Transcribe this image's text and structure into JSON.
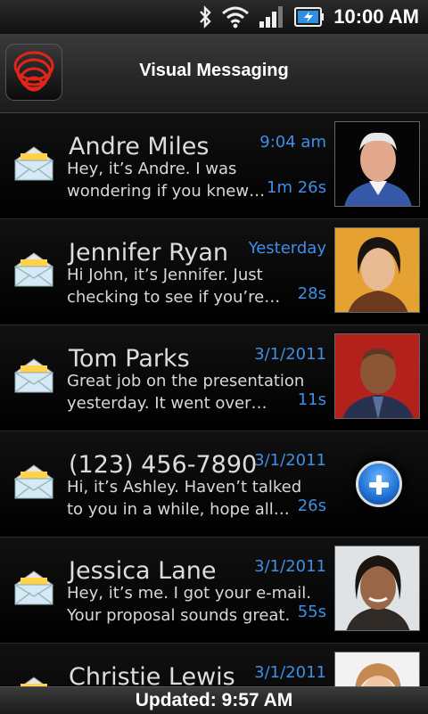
{
  "status_bar": {
    "time": "10:00 AM",
    "icons": [
      "bluetooth-icon",
      "wifi-icon",
      "signal-icon",
      "battery-charging-icon"
    ]
  },
  "app": {
    "title": "Visual Messaging",
    "logo": "app-logo-icon"
  },
  "messages": [
    {
      "name": "Andre Miles",
      "when": "9:04 am",
      "duration": "1m 26s",
      "preview_line1": "Hey, it’s Andre. I was",
      "preview_line2": "wondering if you knew…",
      "photo": "contact-photo"
    },
    {
      "name": "Jennifer Ryan",
      "when": "Yesterday",
      "duration": "28s",
      "preview_line1": "Hi John, it’s Jennifer. Just",
      "preview_line2": "checking to see if you’re…",
      "photo": "contact-photo"
    },
    {
      "name": "Tom Parks",
      "when": "3/1/2011",
      "duration": "11s",
      "preview_line1": "Great job on the presentation",
      "preview_line2": "yesterday. It went over…",
      "photo": "contact-photo"
    },
    {
      "name": "(123) 456-7890",
      "when": "3/1/2011",
      "duration": "26s",
      "preview_line1": "Hi, it’s Ashley. Haven’t talked",
      "preview_line2": "to you in a while, hope all…",
      "photo": "add-contact"
    },
    {
      "name": "Jessica Lane",
      "when": "3/1/2011",
      "duration": "55s",
      "preview_line1": "Hey, it’s me. I got your e-mail.",
      "preview_line2": "Your proposal sounds great.",
      "photo": "contact-photo"
    },
    {
      "name": "Christie Lewis",
      "when": "3/1/2011",
      "duration": "",
      "preview_line1": "",
      "preview_line2": "",
      "photo": "contact-photo"
    }
  ],
  "footer": {
    "updated": "Updated: 9:57 AM"
  },
  "colors": {
    "accent_blue": "#3d8fe8",
    "background": "#000000"
  }
}
